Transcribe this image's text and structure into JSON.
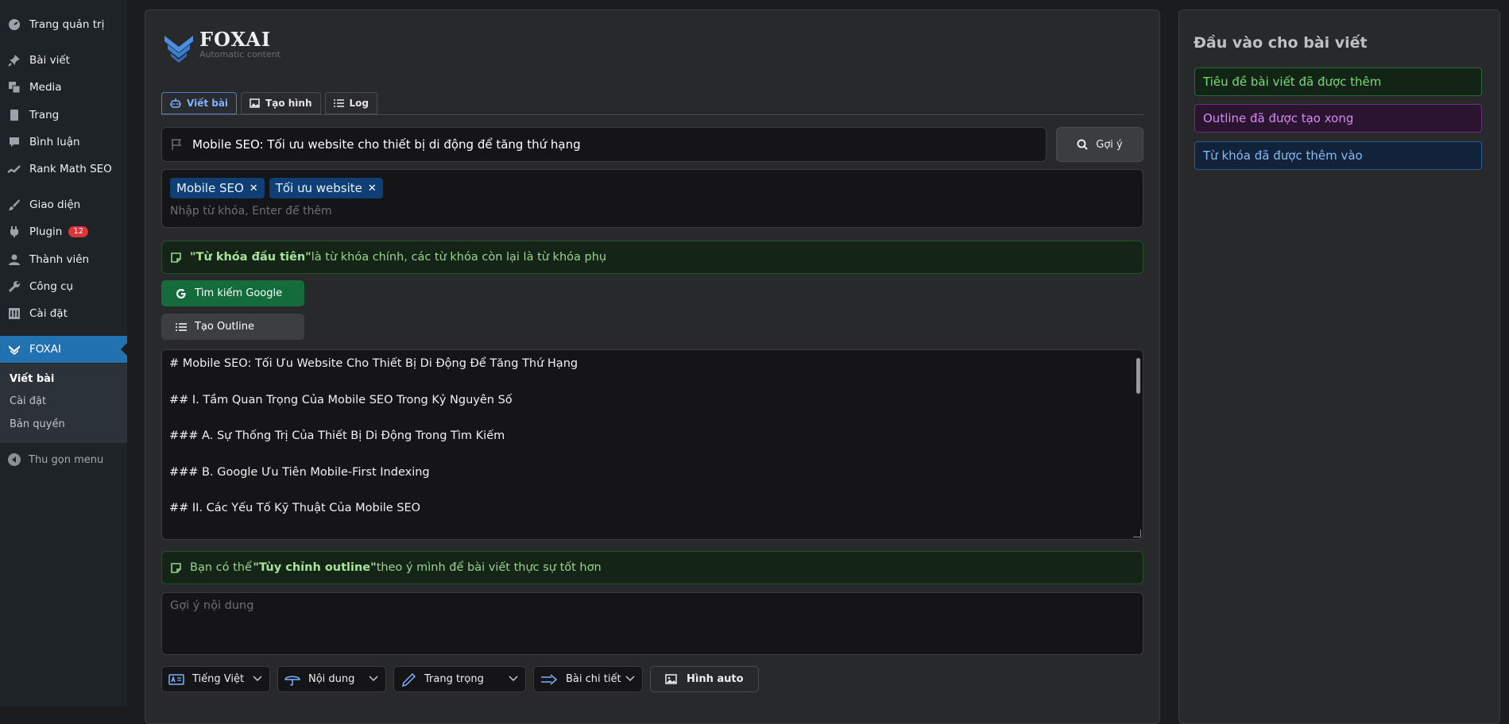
{
  "sidebar": {
    "items": [
      {
        "label": "Trang quản trị",
        "icon": "dashboard-icon"
      },
      {
        "label": "Bài viết",
        "icon": "pin-icon"
      },
      {
        "label": "Media",
        "icon": "media-icon"
      },
      {
        "label": "Trang",
        "icon": "page-icon"
      },
      {
        "label": "Bình luận",
        "icon": "comment-icon"
      },
      {
        "label": "Rank Math SEO",
        "icon": "rankmath-icon"
      },
      {
        "label": "Giao diện",
        "icon": "brush-icon"
      },
      {
        "label": "Plugin",
        "icon": "plugin-icon",
        "badge": "12"
      },
      {
        "label": "Thành viên",
        "icon": "user-icon"
      },
      {
        "label": "Công cụ",
        "icon": "wrench-icon"
      },
      {
        "label": "Cài đặt",
        "icon": "settings-icon"
      },
      {
        "label": "FOXAI",
        "icon": "foxai-icon"
      }
    ],
    "submenu": [
      "Viết bài",
      "Cài đặt",
      "Bản quyền"
    ],
    "collapse_label": "Thu gọn menu"
  },
  "logo": {
    "title": "FOXAI",
    "subtitle": "Automatic content"
  },
  "tabs": [
    "Viết bài",
    "Tạo hình",
    "Log"
  ],
  "title_input": {
    "value": "Mobile SEO: Tối ưu website cho thiết bị di động để tăng thứ hạng"
  },
  "suggest_button": "Gợi ý",
  "keywords": {
    "chips": [
      "Mobile SEO",
      "Tối ưu website"
    ],
    "placeholder": "Nhập từ khóa, Enter để thêm"
  },
  "note_keyword": {
    "bold": "\"Từ khóa đầu tiên\"",
    "rest": " là từ khóa chính, các từ khóa còn lại là từ khóa phụ"
  },
  "buttons": {
    "google": "Tìm kiếm Google",
    "outline": "Tạo Outline"
  },
  "outline_lines": [
    "# Mobile SEO: Tối Ưu Website Cho Thiết Bị Di Động Để Tăng Thứ Hạng",
    "## I. Tầm Quan Trọng Của Mobile SEO Trong Kỷ Nguyên Số",
    "### A. Sự Thống Trị Của Thiết Bị Di Động Trong Tìm Kiếm",
    "### B. Google Ưu Tiên Mobile-First Indexing",
    "## II. Các Yếu Tố Kỹ Thuật Của Mobile SEO"
  ],
  "note_outline": {
    "pre": "Bạn có thể ",
    "bold": "\"Tùy chỉnh outline\"",
    "post": " theo ý mình để bài viết thực sự tốt hơn"
  },
  "content_suggest": {
    "placeholder": "Gợi ý nội dung"
  },
  "selects": {
    "language": "Tiếng Việt",
    "type": "Nội dung",
    "tone": "Trang trọng",
    "length": "Bài chi tiết"
  },
  "image_button": "Hình auto",
  "side_panel": {
    "title": "Đầu vào cho bài viết",
    "statuses": [
      "Tiêu đề bài viết đã được thêm",
      "Outline đã được tạo xong",
      "Từ khóa đã được thêm vào"
    ]
  },
  "colors": {
    "accent": "#2271b1",
    "success_bg": "#146c3c",
    "chip_bg": "#0f3f75"
  }
}
